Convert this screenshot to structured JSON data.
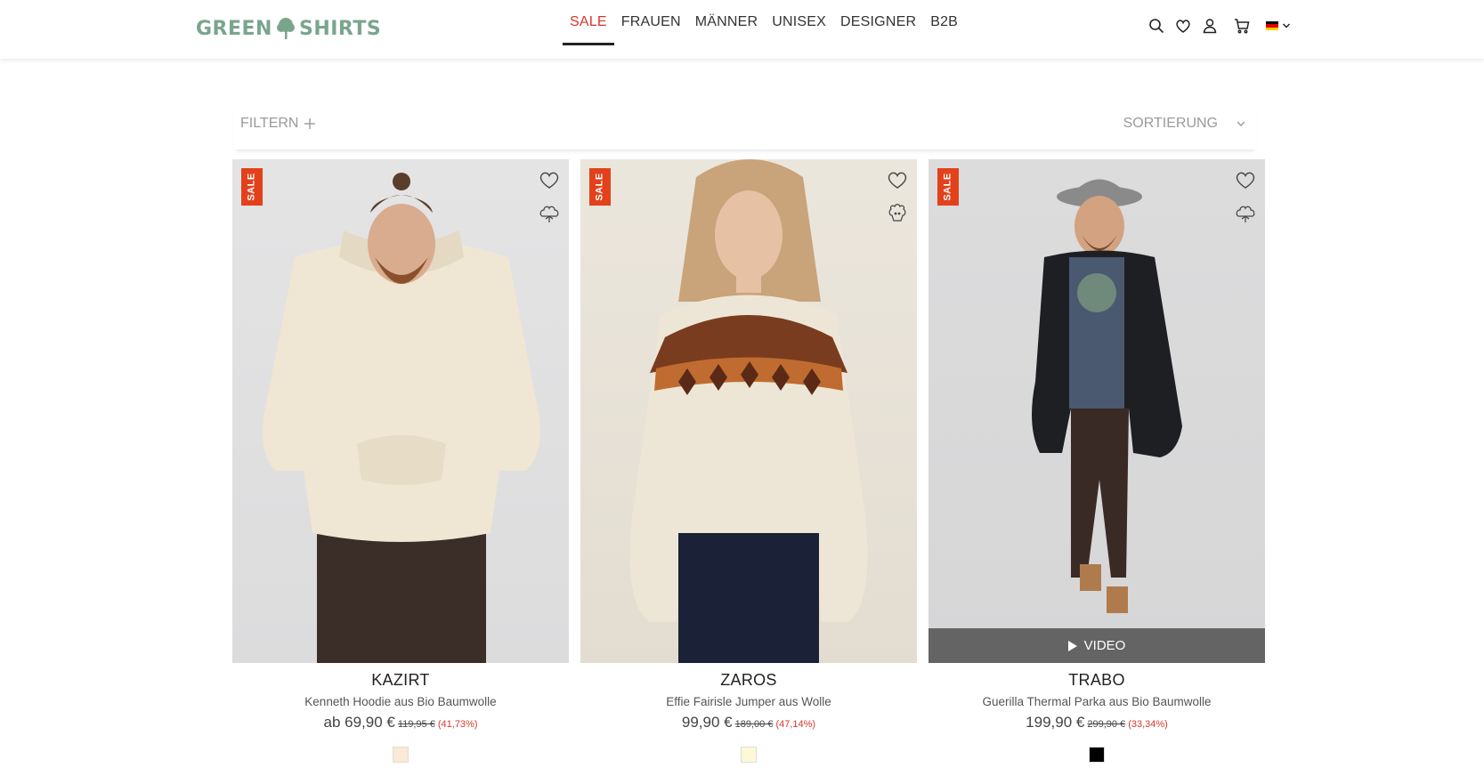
{
  "header": {
    "logo_left": "GREEN",
    "logo_right": "SHIRTS",
    "nav": [
      {
        "label": "SALE",
        "active": true
      },
      {
        "label": "FRAUEN"
      },
      {
        "label": "MÄNNER"
      },
      {
        "label": "UNISEX"
      },
      {
        "label": "DESIGNER"
      },
      {
        "label": "B2B"
      }
    ],
    "icons": [
      "search-icon",
      "heart-icon",
      "user-icon",
      "cart-icon",
      "german-flag-icon",
      "chevron-down-icon"
    ]
  },
  "toolbar": {
    "filter_label": "FILTERN",
    "sort_label": "SORTIERUNG"
  },
  "products": [
    {
      "badge": "SALE",
      "name": "KAZIRT",
      "desc": "Kenneth Hoodie aus Bio Baumwolle",
      "price": "ab 69,90 €",
      "old_price": "119,95 €",
      "discount": "(41,73%)",
      "material_icon": "cotton-icon",
      "swatch": "#fbe9d5",
      "video": false
    },
    {
      "badge": "SALE",
      "name": "ZAROS",
      "desc": "Effie Fairisle Jumper aus Wolle",
      "price": "99,90 €",
      "old_price": "189,00 €",
      "discount": "(47,14%)",
      "material_icon": "sheep-icon",
      "swatch": "#fdf8d6",
      "video": false
    },
    {
      "badge": "SALE",
      "name": "TRABO",
      "desc": "Guerilla Thermal Parka aus Bio Baumwolle",
      "price": "199,90 €",
      "old_price": "299,90 €",
      "discount": "(33,34%)",
      "material_icon": "cotton-icon",
      "swatch": "#000000",
      "video": true,
      "video_label": "VIDEO"
    }
  ],
  "colors": {
    "accent_red": "#d9362a",
    "sale_badge": "#e2411b",
    "logo_green": "#7aa58d"
  }
}
